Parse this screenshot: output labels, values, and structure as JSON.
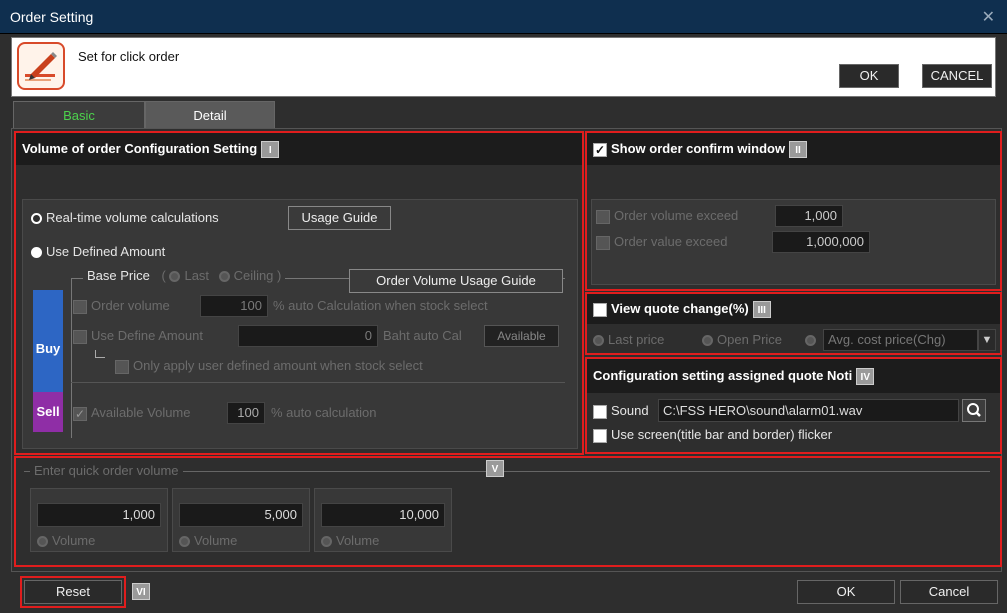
{
  "window": {
    "title": "Order Setting",
    "close_icon": "close-icon"
  },
  "header": {
    "description": "Set for click order",
    "ok_label": "OK",
    "cancel_label": "CANCEL"
  },
  "tabs": [
    {
      "label": "Basic",
      "active": true
    },
    {
      "label": "Detail",
      "active": false
    }
  ],
  "colors": {
    "accent_red": "#e01d1d",
    "active_tab_text": "#4cd24c",
    "buy": "#2d66c4",
    "sell": "#8f2ea6"
  },
  "volume_section": {
    "title": "Volume of order Configuration Setting",
    "badge": "I",
    "realtime_label": "Real-time volume calculations",
    "usage_guide_label": "Usage Guide",
    "defined_amount_label": "Use Defined Amount",
    "base_price_label": "Base Price",
    "base_price_open": "(",
    "base_price_close": ")",
    "last_label": "Last",
    "ceiling_label": "Ceiling",
    "order_volume_guide_label": "Order Volume Usage Guide",
    "buy_label": "Buy",
    "sell_label": "Sell",
    "order_volume_label": "Order volume",
    "order_volume_value": "100",
    "order_volume_suffix": "% auto Calculation when stock select",
    "define_amount_label": "Use Define Amount",
    "define_amount_value": "0",
    "baht_suffix": "Baht auto Cal",
    "available_tag": "Available",
    "only_apply_label": "Only apply user defined amount when stock select",
    "available_volume_label": "Available Volume",
    "available_volume_value": "100",
    "available_volume_suffix": "% auto calculation"
  },
  "confirm_section": {
    "title": "Show order confirm window",
    "badge": "II",
    "volume_exceed_label": "Order volume exceed",
    "volume_exceed_value": "1,000",
    "value_exceed_label": "Order value exceed",
    "value_exceed_value": "1,000,000"
  },
  "quote_change_section": {
    "title": "View quote change(%)",
    "badge": "III",
    "last_price_label": "Last price",
    "open_price_label": "Open Price",
    "avg_cost_value": "Avg. cost price(Chg)"
  },
  "noti_section": {
    "title": "Configuration setting assigned quote Noti",
    "badge": "IV",
    "sound_label": "Sound",
    "sound_path": "C:\\FSS HERO\\sound\\alarm01.wav",
    "flicker_label": "Use screen(title bar and border) flicker"
  },
  "quick_volume": {
    "title": "Enter quick order volume",
    "badge": "V",
    "items": [
      {
        "value": "1,000",
        "label": "Volume"
      },
      {
        "value": "5,000",
        "label": "Volume"
      },
      {
        "value": "10,000",
        "label": "Volume"
      }
    ]
  },
  "footer": {
    "reset_label": "Reset",
    "badge": "VI",
    "ok_label": "OK",
    "cancel_label": "Cancel"
  }
}
